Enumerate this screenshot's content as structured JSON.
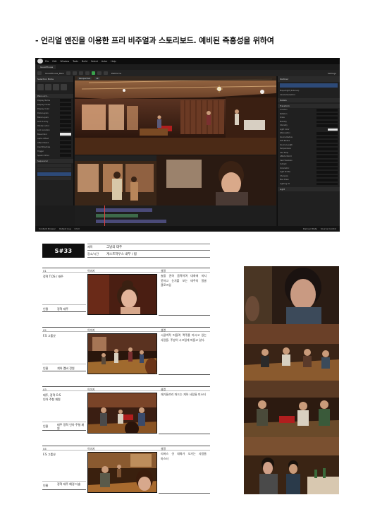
{
  "heading": "- 언리얼 엔진을 이용한 프리 비주얼과 스토리보드. 예비된 즉흥성을 위하여",
  "editor": {
    "menu": [
      "File",
      "Edit",
      "Window",
      "Tools",
      "Build",
      "Select",
      "Actor",
      "Help"
    ],
    "level_tab": "GuestHouse",
    "file_tab": "GuestHouse_Main",
    "perspective_label": "Perspective",
    "lit_label": "Lit",
    "platforms_label": "Platforms",
    "settings_label": "Settings",
    "project_label": "Project",
    "left_panel_title": "Selection Mode",
    "place_label": "Place Act...",
    "details_title": "Details",
    "outliner_title": "Outliner",
    "selected_actor": "PlayerLight (Instance)",
    "cinecam_label": "CineCameraActor",
    "transform_label": "Transform",
    "light_label": "Light",
    "sequencer_title": "Sequencer",
    "content_drawer": "Content Drawer",
    "output_log": "Output Log",
    "cmd_label": "Cmd",
    "derived_label": "Derived Data",
    "source_label": "Source Control",
    "left_rows": [
      "Display Name",
      "Display Folder",
      "Display Color",
      "Data Layers",
      "Bake Layers",
      "Sort Priority",
      "Hidden Actor",
      "Lock Location",
      "Base Color",
      "Alpha Offset",
      "Affect World",
      "Cast Shadows",
      "Trigger",
      "Spawn Order"
    ],
    "right_rows": [
      "Location",
      "Rotation",
      "Scale",
      "Mobility",
      "Intensity",
      "Light Color",
      "Attenuation",
      "Source Radius",
      "Soft Radius",
      "Source Length",
      "Temperature",
      "Use Temp",
      "Affects World",
      "Cast Shadows",
      "Indirect",
      "Volumetric",
      "Light Profile",
      "Channels",
      "Max Draw",
      "Lighting Ch"
    ]
  },
  "scene": {
    "number": "S#33",
    "labels": {
      "title": "제목",
      "place_time": "장소/시간"
    },
    "title": "그날의 태주",
    "place_time": "게스트하우스 내부 / 밤"
  },
  "shot_labels": {
    "image": "이미지",
    "description": "설명",
    "character": "인물"
  },
  "shots": [
    {
      "no": "01",
      "desc": "정혁 T.OS / 태주",
      "character": "정혁 태주",
      "explanation": "술을 권하 몸짝이며 대화에 끼지 못하고 눈치를 보는 태주의 얼굴 클로즈업"
    },
    {
      "no": "02",
      "desc": "F.S 그룹샷",
      "character": "게하 멤버 전원",
      "explanation": "시끌벅적 떠들며 맥주를 마시고 있는 사람들. 주방이 시끄럽게 떠들고 있다."
    },
    {
      "no": "03",
      "desc": "태주, 정혁 O.S\n인아 주형 재원",
      "character": "태주 정혁 인아 주형 재원",
      "explanation": "재기들끼리 떠드는 게하 사람들 미스터"
    },
    {
      "no": "04",
      "desc": "F.S 그룹샷",
      "character": "정혁 태주 예경 다솔",
      "explanation": "리버스 샷 대화가 오가는 사람들 마스터"
    }
  ],
  "colors": {
    "scene_badge": "#0f0f0f",
    "editor_bg": "#151515",
    "selection": "#2d4a78"
  }
}
